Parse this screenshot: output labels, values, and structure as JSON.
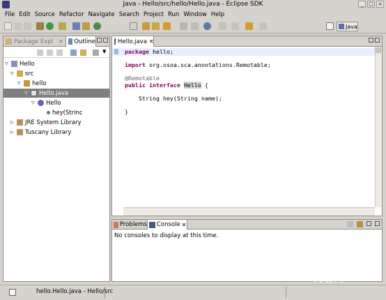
{
  "window": {
    "title": "Java - Hello/src/hello/Hello.java - Eclipse SDK"
  },
  "menu": [
    "File",
    "Edit",
    "Source",
    "Refactor",
    "Navigate",
    "Search",
    "Project",
    "Run",
    "Window",
    "Help"
  ],
  "perspective": {
    "label": "Java"
  },
  "left_pane": {
    "tabs": [
      {
        "label": "Package Expl"
      },
      {
        "label": "Outline"
      }
    ],
    "tree": [
      {
        "label": "Hello",
        "icon": "project-icon"
      },
      {
        "label": "src",
        "icon": "source-folder-icon"
      },
      {
        "label": "hello",
        "icon": "package-icon"
      },
      {
        "label": "Hello.java",
        "icon": "java-file-icon",
        "selected": true
      },
      {
        "label": "Hello",
        "icon": "interface-icon"
      },
      {
        "label": "hey(Strinc",
        "icon": "method-icon"
      },
      {
        "label": "JRE System Library",
        "icon": "library-icon"
      },
      {
        "label": "Tuscany Library",
        "icon": "library-icon"
      }
    ]
  },
  "editor": {
    "tab_label": "Hello.java",
    "code": {
      "l1_kw": "package",
      "l1_rest": " hello;",
      "l2_kw": "import",
      "l2_rest": " org.osoa.sca.annotations.Remotable;",
      "l3": "@Remotable",
      "l4_kw": "public interface",
      "l4_sp": " ",
      "l4_name": "Hello",
      "l4_rest": " {",
      "l5": "    String hey(String name);",
      "l6": "}"
    }
  },
  "console": {
    "tabs": [
      {
        "label": "Problems"
      },
      {
        "label": "Console"
      }
    ],
    "message": "No consoles to display at this time."
  },
  "status": {
    "text": "hello.Hello.java - Hello/src"
  },
  "watermark": {
    "main": "yesky",
    "sub": "天极网"
  }
}
